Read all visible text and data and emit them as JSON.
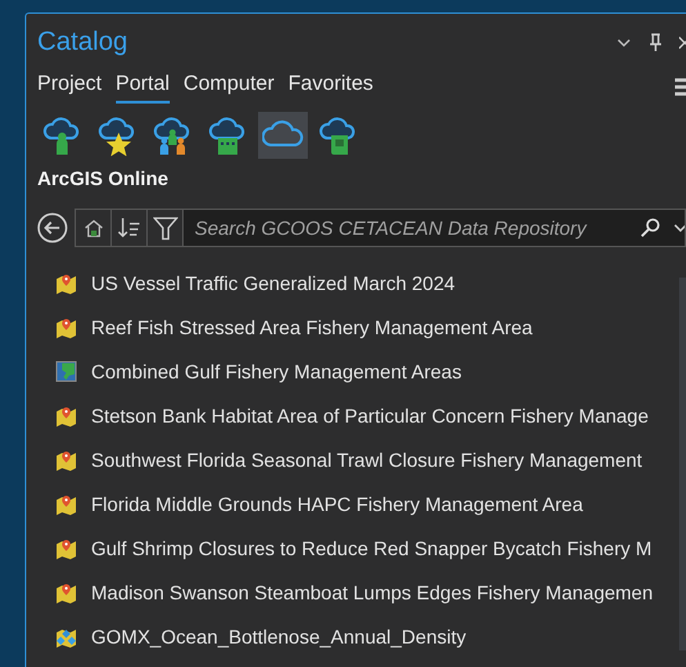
{
  "panel": {
    "title": "Catalog"
  },
  "tabs": [
    {
      "label": "Project",
      "selected": false
    },
    {
      "label": "Portal",
      "selected": true
    },
    {
      "label": "Computer",
      "selected": false
    },
    {
      "label": "Favorites",
      "selected": false
    }
  ],
  "portal_buttons": [
    {
      "kind": "user",
      "selected": false
    },
    {
      "kind": "favorite",
      "selected": false
    },
    {
      "kind": "groups",
      "selected": false
    },
    {
      "kind": "organization",
      "selected": false
    },
    {
      "kind": "online",
      "selected": true
    },
    {
      "kind": "living-atlas",
      "selected": false
    }
  ],
  "location": "ArcGIS Online",
  "search": {
    "placeholder": "Search GCOOS CETACEAN Data Repository"
  },
  "items": [
    {
      "kind": "map",
      "label": "US Vessel Traffic Generalized March 2024"
    },
    {
      "kind": "map",
      "label": "Reef Fish Stressed Area Fishery Management Area"
    },
    {
      "kind": "imagery",
      "label": "Combined Gulf Fishery Management Areas"
    },
    {
      "kind": "map",
      "label": "Stetson Bank Habitat Area of Particular Concern Fishery Manage"
    },
    {
      "kind": "map",
      "label": "Southwest Florida Seasonal Trawl Closure Fishery Management"
    },
    {
      "kind": "map",
      "label": "Florida Middle Grounds HAPC Fishery Management Area"
    },
    {
      "kind": "map",
      "label": "Gulf Shrimp Closures to Reduce Red Snapper Bycatch Fishery M"
    },
    {
      "kind": "map",
      "label": "Madison Swanson Steamboat Lumps Edges Fishery Managemen"
    },
    {
      "kind": "tile",
      "label": "GOMX_Ocean_Bottlenose_Annual_Density"
    }
  ]
}
